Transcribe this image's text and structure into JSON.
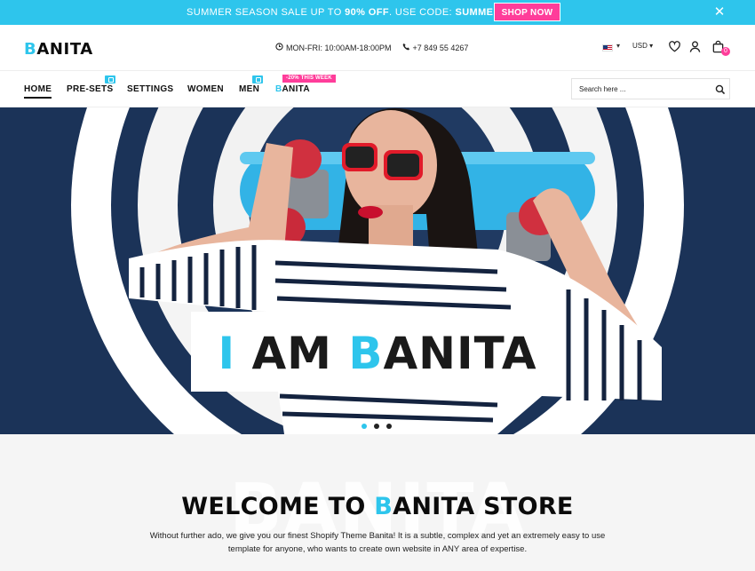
{
  "colors": {
    "accent": "#2ec5ec",
    "sale": "#ff3d9a",
    "dark": "#111111"
  },
  "promo": {
    "prefix": "SUMMER SEASON SALE UP TO ",
    "discount": "90% OFF",
    "middle": ". USE CODE: ",
    "code": "SUMMER.",
    "button": "SHOP NOW",
    "close_icon": "close-icon"
  },
  "header": {
    "logo_first": "B",
    "logo_rest": "ANITA",
    "hours": "MON-FRI: 10:00AM-18:00PM",
    "phone": "+7 849 55 4267",
    "currency": "USD",
    "cart_count": "0"
  },
  "nav": {
    "items": [
      {
        "label": "HOME"
      },
      {
        "label": "PRE-SETS"
      },
      {
        "label": "SETTINGS"
      },
      {
        "label": "WOMEN"
      },
      {
        "label": "MEN"
      },
      {
        "label_first": "B",
        "label_rest": "ANITA"
      }
    ],
    "sale_tag": "-20% THIS WEEK",
    "search_placeholder": "Search here ..."
  },
  "hero": {
    "title_first": "I AM ",
    "title_b": "B",
    "title_rest": "ANITA",
    "slides": 3,
    "active_slide": 1
  },
  "welcome": {
    "bg_word": "BANITA",
    "title_first": "WELCOME TO ",
    "title_b": "B",
    "title_rest": "ANITA STORE",
    "text": "Without further ado, we give you our finest Shopify Theme Banita! It is a subtle, complex and yet an extremely easy to use template for anyone, who wants to create own website in ANY area of expertise."
  }
}
